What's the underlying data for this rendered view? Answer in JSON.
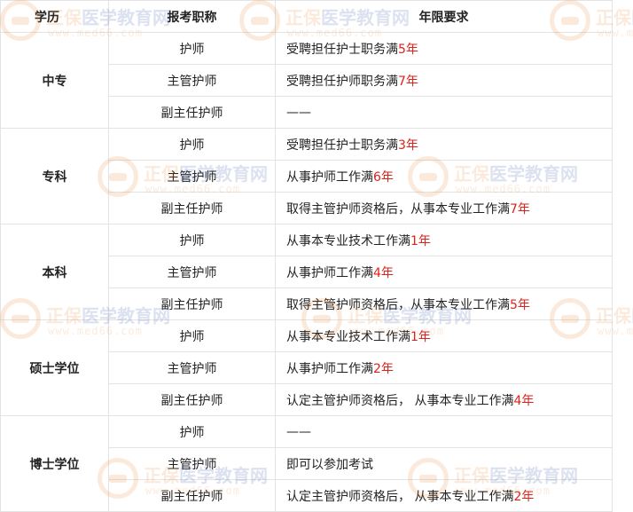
{
  "table": {
    "headers": [
      "学历",
      "报考职称",
      "年限要求"
    ],
    "groups": [
      {
        "education": "中专",
        "rows": [
          {
            "title": "护师",
            "text": "受聘担任护士职务满",
            "num": "5年"
          },
          {
            "title": "主管护师",
            "text": "受聘担任护师职务满",
            "num": "7年"
          },
          {
            "title": "副主任护师",
            "text": "——",
            "num": ""
          }
        ]
      },
      {
        "education": "专科",
        "rows": [
          {
            "title": "护师",
            "text": "受聘担任护士职务满",
            "num": "3年"
          },
          {
            "title": "主管护师",
            "text": "从事护师工作满",
            "num": "6年"
          },
          {
            "title": "副主任护师",
            "text": "取得主管护师资格后，从事本专业工作满",
            "num": "7年"
          }
        ]
      },
      {
        "education": "本科",
        "rows": [
          {
            "title": "护师",
            "text": "从事本专业技术工作满",
            "num": "1年"
          },
          {
            "title": "主管护师",
            "text": "从事护师工作满",
            "num": "4年"
          },
          {
            "title": "副主任护师",
            "text": "取得主管护师资格后，从事本专业工作满",
            "num": "5年"
          }
        ]
      },
      {
        "education": "硕士学位",
        "rows": [
          {
            "title": "护师",
            "text": "从事本专业技术工作满",
            "num": "1年"
          },
          {
            "title": "主管护师",
            "text": "从事护师工作满",
            "num": "2年"
          },
          {
            "title": "副主任护师",
            "text": "认定主管护师资格后， 从事本专业工作满",
            "num": "4年"
          }
        ]
      },
      {
        "education": "博士学位",
        "rows": [
          {
            "title": "护师",
            "text": "——",
            "num": ""
          },
          {
            "title": "主管护师",
            "text": "即可以参加考试",
            "num": ""
          },
          {
            "title": "副主任护师",
            "text": "认定主管护师资格后， 从事本专业工作满",
            "num": "2年"
          }
        ]
      }
    ]
  },
  "watermark": {
    "brand_a": "正保",
    "brand_b": "医学教育网",
    "url": "www.med66.com"
  },
  "colors": {
    "highlight": "#e0211a",
    "border": "#e3e3e3",
    "watermark_orange": "#e8832a",
    "watermark_blue": "#2a4ea0"
  }
}
